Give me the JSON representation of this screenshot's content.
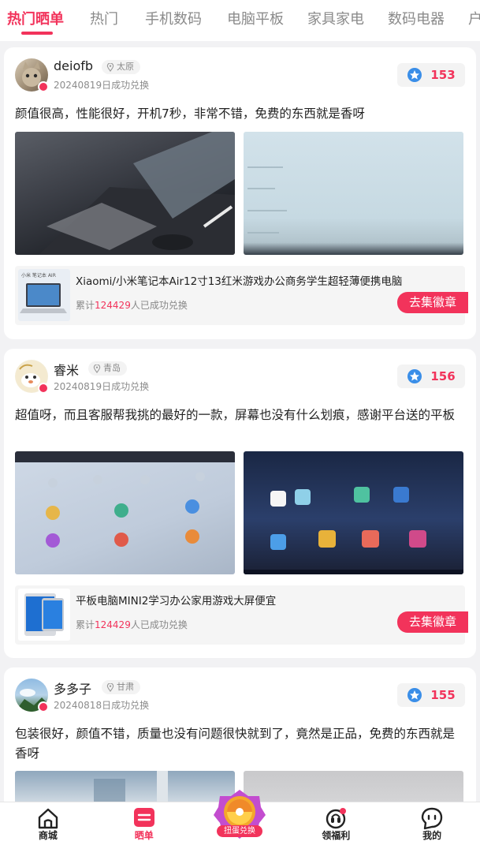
{
  "tabs": [
    "热门晒单",
    "热门",
    "手机数码",
    "电脑平板",
    "家具家电",
    "数码电器",
    "户"
  ],
  "posts": [
    {
      "username": "deiofb",
      "location": "太原",
      "date": "20240819日成功兑换",
      "score": "153",
      "review": "颜值很高，性能很好，开机7秒，非常不错，免费的东西就是香呀",
      "product_title": "Xiaomi/小米笔记本Air12寸13红米游戏办公商务学生超轻薄便携电脑",
      "product_stat_prefix": "累计",
      "product_stat_count": "124429",
      "product_stat_suffix": "人已成功兑换",
      "product_button": "去集徽章",
      "product_thumb_text": "小米 笔记本 AIR"
    },
    {
      "username": "睿米",
      "location": "青岛",
      "date": "20240819日成功兑换",
      "score": "156",
      "review": "超值呀，而且客服帮我挑的最好的一款，屏幕也没有什么划痕，感谢平台送的平板",
      "product_title": "平板电脑MINI2学习办公家用游戏大屏便宜",
      "product_stat_prefix": "累计",
      "product_stat_count": "124429",
      "product_stat_suffix": "人已成功兑换",
      "product_button": "去集徽章"
    },
    {
      "username": "多多子",
      "location": "甘肃",
      "date": "20240818日成功兑换",
      "score": "155",
      "review": "包装很好，颜值不错，质量也没有问题很快就到了，竟然是正品，免费的东西就是香呀"
    }
  ],
  "bottom_nav": {
    "mall": "商城",
    "posts": "晒单",
    "center": "扭蛋兑换",
    "welfare": "领福利",
    "me": "我的"
  },
  "colors": {
    "accent": "#f2335b",
    "score_icon": "#3a8ee8"
  }
}
